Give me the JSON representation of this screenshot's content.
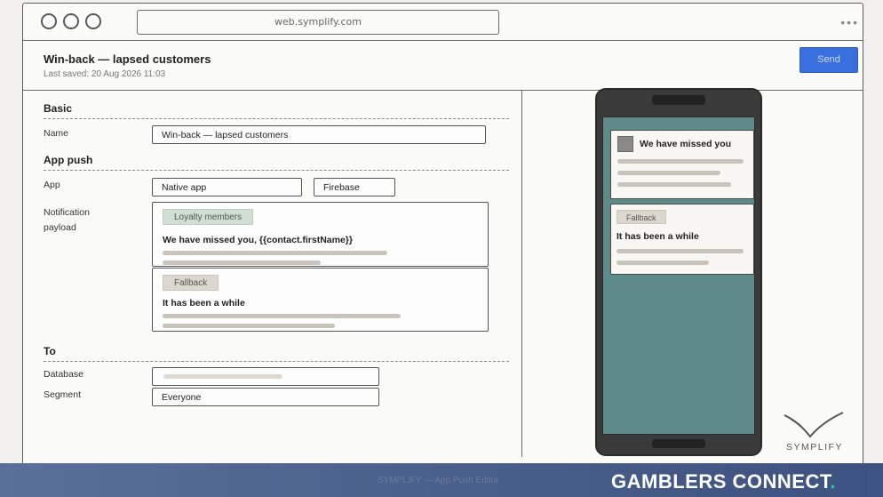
{
  "browser": {
    "url": "web.symplify.com",
    "menu_glyph": "•••"
  },
  "header": {
    "title": "Win-back — lapsed customers",
    "last_saved": "Last saved: 20 Aug 2026 11:03",
    "send_label": "Send"
  },
  "basic": {
    "section_title": "Basic",
    "name_label": "Name",
    "name_value": "Win-back — lapsed customers"
  },
  "app_push": {
    "section_title": "App push",
    "app_label": "App",
    "app_value": "Native app",
    "provider_value": "Firebase",
    "payload_label_line1": "Notification",
    "payload_label_line2": "payload",
    "variants": [
      {
        "tag": "Loyalty members",
        "heading": "We have missed you, {{contact.firstName}}"
      },
      {
        "tag": "Fallback",
        "heading": "It has been a while"
      }
    ]
  },
  "to": {
    "section_title": "To",
    "database_label": "Database",
    "segment_label": "Segment",
    "segment_value": "Everyone"
  },
  "preview": {
    "notification1_title": "We have missed you",
    "notification2_tag": "Fallback",
    "notification2_title": "It has been a while"
  },
  "logo": {
    "text": "SYMPLIFY"
  },
  "footer": {
    "caption": "SYMPLIFY — App Push Editor",
    "brand": "GAMBLERS CONNECT",
    "brand_dot": "."
  },
  "colors": {
    "accent_blue": "#3a6fe0",
    "phone_screen": "#5f8a8a",
    "footer_band": "#4b5f8c",
    "brand_dot": "#2ec4c0"
  }
}
